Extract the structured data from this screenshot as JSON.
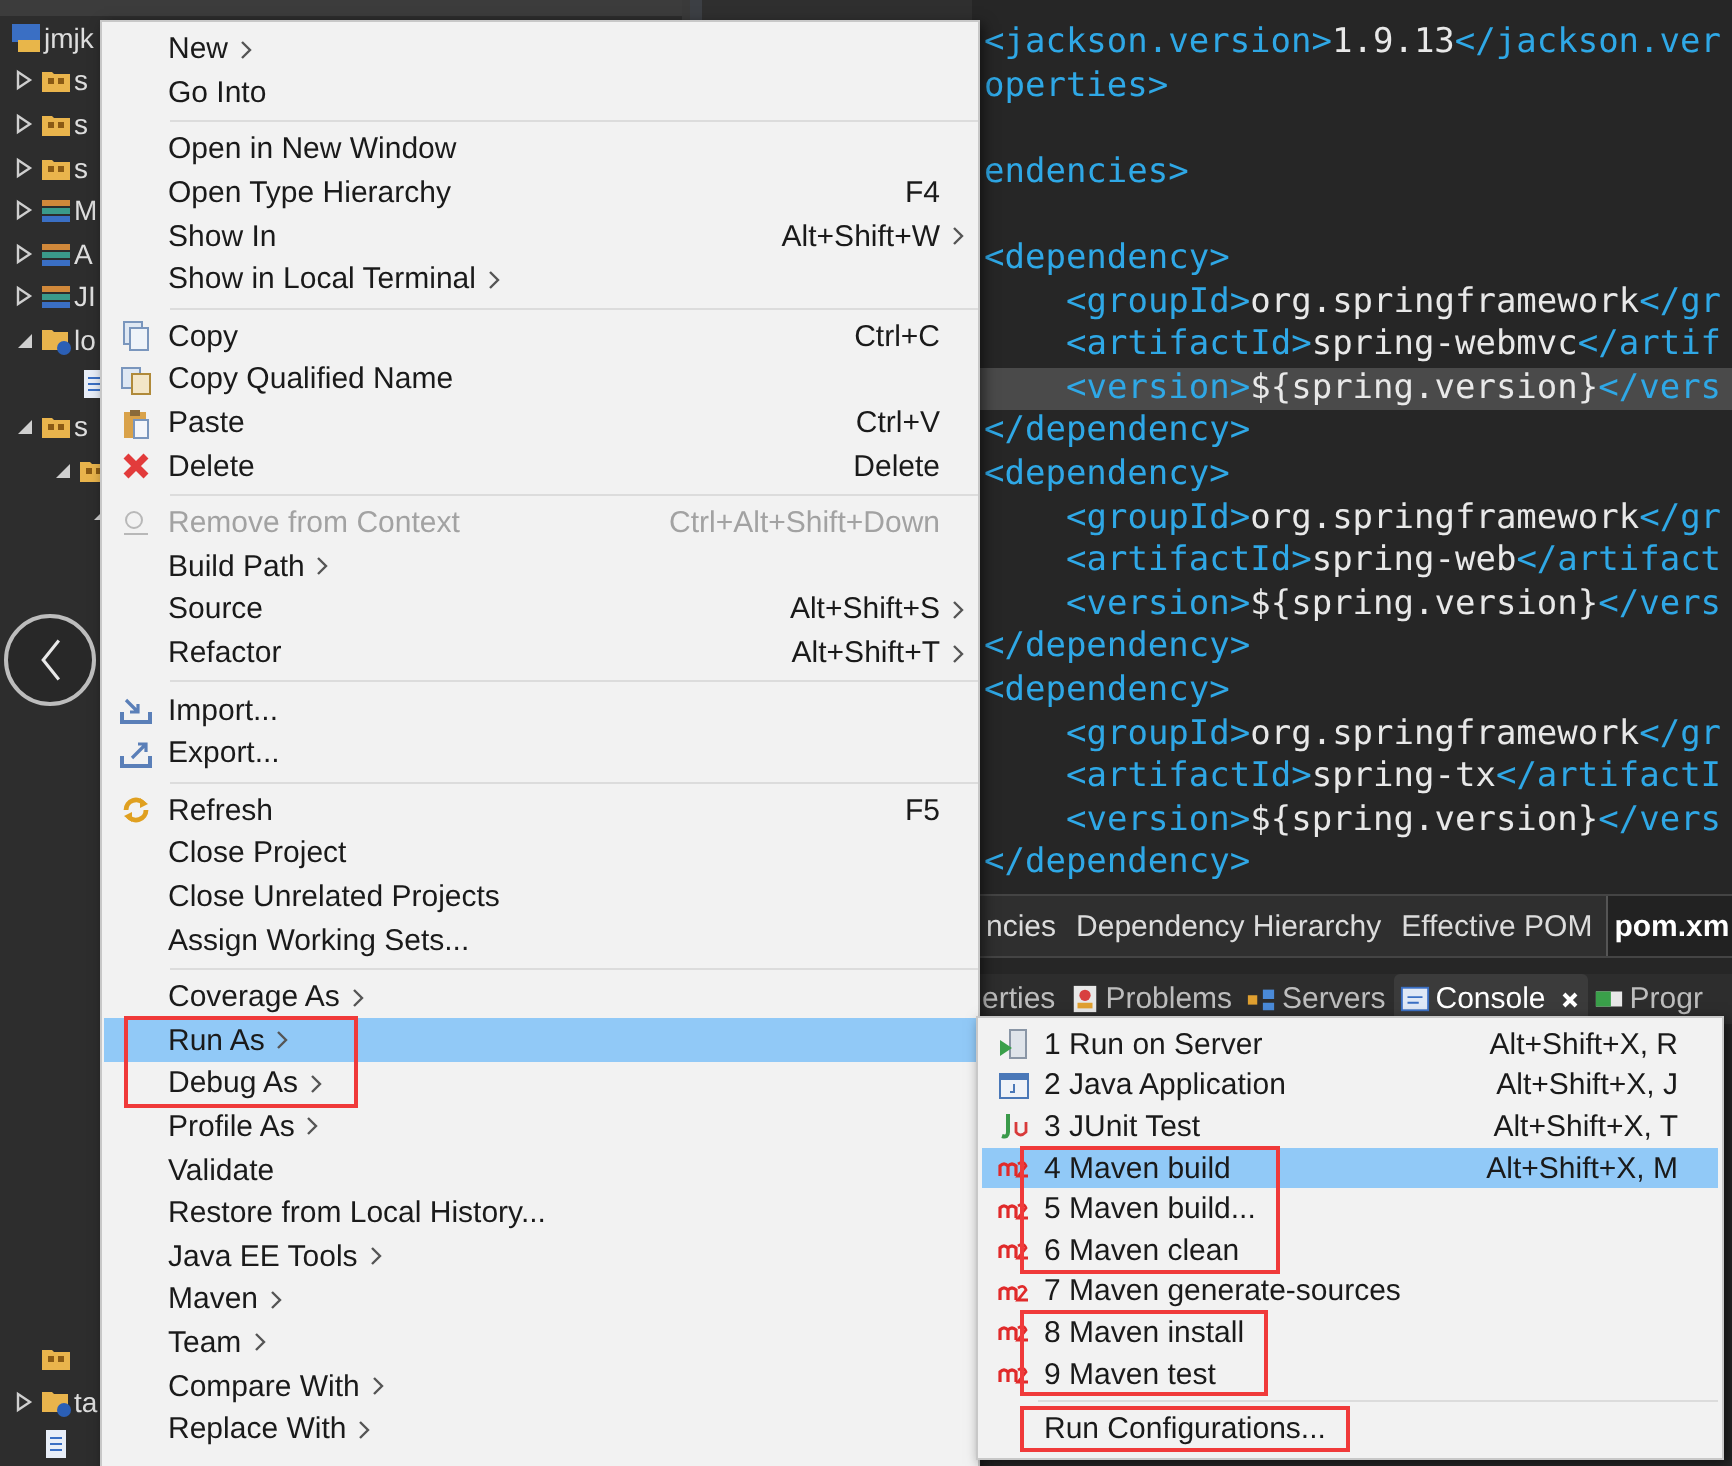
{
  "explorer": {
    "tree": [
      {
        "label": "jmjk",
        "kind": "project",
        "children": [
          {
            "label": "s",
            "kind": "package",
            "expanded": false
          },
          {
            "label": "s",
            "kind": "package",
            "expanded": false
          },
          {
            "label": "s",
            "kind": "package",
            "expanded": false
          },
          {
            "label": "M",
            "kind": "library",
            "expanded": false
          },
          {
            "label": "A",
            "kind": "library",
            "expanded": false
          },
          {
            "label": "JI",
            "kind": "library",
            "expanded": false
          },
          {
            "label": "lo",
            "kind": "folder",
            "expanded": true,
            "children": [
              {
                "kind": "file"
              }
            ]
          },
          {
            "label": "s",
            "kind": "package",
            "expanded": true,
            "children": [
              {
                "kind": "package",
                "expanded": true,
                "children": [
                  {
                    "expanded": true
                  }
                ]
              }
            ]
          }
        ]
      }
    ],
    "tree_end": [
      {
        "kind": "package"
      },
      {
        "label": "ta",
        "kind": "folder",
        "expanded": false
      },
      {
        "kind": "file"
      }
    ]
  },
  "editor": {
    "code": [
      {
        "current": false,
        "nested": false,
        "spaced": false,
        "segments": [
          {
            "kind": "tag",
            "text": "<jackson.version>"
          },
          {
            "kind": "value",
            "text": "1.9.13"
          },
          {
            "kind": "tag",
            "text": "</jackson.ver"
          }
        ]
      },
      {
        "current": false,
        "nested": false,
        "spaced": false,
        "segments": [
          {
            "kind": "tag",
            "text": "operties>"
          }
        ]
      },
      {
        "current": false,
        "nested": false,
        "spaced": true,
        "segments": [
          {
            "kind": "tag",
            "text": "endencies>"
          }
        ]
      },
      {
        "current": false,
        "nested": false,
        "spaced": true,
        "segments": [
          {
            "kind": "tag",
            "text": "<dependency>"
          }
        ]
      },
      {
        "current": false,
        "nested": true,
        "spaced": false,
        "segments": [
          {
            "kind": "tag",
            "text": "<groupId>"
          },
          {
            "kind": "value",
            "text": "org.springframework"
          },
          {
            "kind": "tag",
            "text": "</gr"
          }
        ]
      },
      {
        "current": false,
        "nested": true,
        "spaced": false,
        "segments": [
          {
            "kind": "tag",
            "text": "<artifactId>"
          },
          {
            "kind": "value",
            "text": "spring-webmvc"
          },
          {
            "kind": "tag",
            "text": "</artif"
          }
        ]
      },
      {
        "current": true,
        "nested": true,
        "spaced": false,
        "segments": [
          {
            "kind": "tag",
            "text": "<version>"
          },
          {
            "kind": "value",
            "text": "${spring.version}"
          },
          {
            "kind": "tag",
            "text": "</vers"
          }
        ]
      },
      {
        "current": false,
        "nested": false,
        "spaced": false,
        "segments": [
          {
            "kind": "tag",
            "text": "</dependency>"
          }
        ]
      },
      {
        "current": false,
        "nested": false,
        "spaced": false,
        "segments": [
          {
            "kind": "tag",
            "text": "<dependency>"
          }
        ]
      },
      {
        "current": false,
        "nested": true,
        "spaced": false,
        "segments": [
          {
            "kind": "tag",
            "text": "<groupId>"
          },
          {
            "kind": "value",
            "text": "org.springframework"
          },
          {
            "kind": "tag",
            "text": "</gr"
          }
        ]
      },
      {
        "current": false,
        "nested": true,
        "spaced": false,
        "segments": [
          {
            "kind": "tag",
            "text": "<artifactId>"
          },
          {
            "kind": "value",
            "text": "spring-web"
          },
          {
            "kind": "tag",
            "text": "</artifact"
          }
        ]
      },
      {
        "current": false,
        "nested": true,
        "spaced": false,
        "segments": [
          {
            "kind": "tag",
            "text": "<version>"
          },
          {
            "kind": "value",
            "text": "${spring.version}"
          },
          {
            "kind": "tag",
            "text": "</vers"
          }
        ]
      },
      {
        "current": false,
        "nested": false,
        "spaced": false,
        "segments": [
          {
            "kind": "tag",
            "text": "</dependency>"
          }
        ]
      },
      {
        "current": false,
        "nested": false,
        "spaced": false,
        "segments": [
          {
            "kind": "tag",
            "text": "<dependency>"
          }
        ]
      },
      {
        "current": false,
        "nested": true,
        "spaced": false,
        "segments": [
          {
            "kind": "tag",
            "text": "<groupId>"
          },
          {
            "kind": "value",
            "text": "org.springframework"
          },
          {
            "kind": "tag",
            "text": "</gr"
          }
        ]
      },
      {
        "current": false,
        "nested": true,
        "spaced": false,
        "segments": [
          {
            "kind": "tag",
            "text": "<artifactId>"
          },
          {
            "kind": "value",
            "text": "spring-tx"
          },
          {
            "kind": "tag",
            "text": "</artifactI"
          }
        ]
      },
      {
        "current": false,
        "nested": true,
        "spaced": false,
        "segments": [
          {
            "kind": "tag",
            "text": "<version>"
          },
          {
            "kind": "value",
            "text": "${spring.version}"
          },
          {
            "kind": "tag",
            "text": "</vers"
          }
        ]
      },
      {
        "current": false,
        "nested": false,
        "spaced": false,
        "segments": [
          {
            "kind": "tag",
            "text": "</dependency>"
          }
        ]
      }
    ],
    "tabs": [
      {
        "label": "ncies",
        "selected": false
      },
      {
        "label": "Dependency Hierarchy",
        "selected": false
      },
      {
        "label": "Effective POM",
        "selected": false
      },
      {
        "label": "pom.xm",
        "selected": true
      }
    ]
  },
  "views": {
    "tabs": [
      {
        "label": "erties",
        "kind": "plain",
        "selected": false,
        "closable": false
      },
      {
        "label": "Problems",
        "kind": "problems",
        "selected": false,
        "closable": false
      },
      {
        "label": "Servers",
        "kind": "servers",
        "selected": false,
        "closable": false
      },
      {
        "label": "Console",
        "kind": "console",
        "selected": true,
        "closable": true
      },
      {
        "label": "Progr",
        "kind": "progress",
        "selected": false,
        "closable": false
      }
    ]
  },
  "context_menu": {
    "groups": [
      [
        {
          "label": "New",
          "kind": "plain",
          "submenu": true,
          "selected": false,
          "disabled": false,
          "outlined": false
        },
        {
          "label": "Go Into",
          "kind": "plain",
          "submenu": false,
          "selected": false,
          "disabled": false,
          "outlined": false
        }
      ],
      [
        {
          "label": "Open in New Window",
          "kind": "plain",
          "submenu": false,
          "selected": false,
          "disabled": false,
          "outlined": false
        },
        {
          "label": "Open Type Hierarchy",
          "shortcut": "F4",
          "kind": "plain",
          "submenu": false,
          "selected": false,
          "disabled": false,
          "outlined": false
        },
        {
          "label": "Show In",
          "shortcut": "Alt+Shift+W",
          "kind": "plain",
          "submenu": true,
          "selected": false,
          "disabled": false,
          "outlined": false
        },
        {
          "label": "Show in Local Terminal",
          "kind": "plain",
          "submenu": true,
          "selected": false,
          "disabled": false,
          "outlined": false
        }
      ],
      [
        {
          "label": "Copy",
          "shortcut": "Ctrl+C",
          "kind": "copy",
          "submenu": false,
          "selected": false,
          "disabled": false,
          "outlined": false
        },
        {
          "label": "Copy Qualified Name",
          "kind": "copy-name",
          "submenu": false,
          "selected": false,
          "disabled": false,
          "outlined": false
        },
        {
          "label": "Paste",
          "shortcut": "Ctrl+V",
          "kind": "paste",
          "submenu": false,
          "selected": false,
          "disabled": false,
          "outlined": false
        },
        {
          "label": "Delete",
          "shortcut": "Delete",
          "kind": "delete",
          "submenu": false,
          "selected": false,
          "disabled": false,
          "outlined": false
        }
      ],
      [
        {
          "label": "Remove from Context",
          "shortcut": "Ctrl+Alt+Shift+Down",
          "kind": "remove",
          "submenu": false,
          "selected": false,
          "disabled": true,
          "outlined": false
        },
        {
          "label": "Build Path",
          "kind": "plain",
          "submenu": true,
          "selected": false,
          "disabled": false,
          "outlined": false
        },
        {
          "label": "Source",
          "shortcut": "Alt+Shift+S",
          "kind": "plain",
          "submenu": true,
          "selected": false,
          "disabled": false,
          "outlined": false
        },
        {
          "label": "Refactor",
          "shortcut": "Alt+Shift+T",
          "kind": "plain",
          "submenu": true,
          "selected": false,
          "disabled": false,
          "outlined": false
        }
      ],
      [
        {
          "label": "Import...",
          "kind": "import",
          "submenu": false,
          "selected": false,
          "disabled": false,
          "outlined": false
        },
        {
          "label": "Export...",
          "kind": "export",
          "submenu": false,
          "selected": false,
          "disabled": false,
          "outlined": false
        }
      ],
      [
        {
          "label": "Refresh",
          "shortcut": "F5",
          "kind": "refresh",
          "submenu": false,
          "selected": false,
          "disabled": false,
          "outlined": false
        },
        {
          "label": "Close Project",
          "kind": "plain",
          "submenu": false,
          "selected": false,
          "disabled": false,
          "outlined": false
        },
        {
          "label": "Close Unrelated Projects",
          "kind": "plain",
          "submenu": false,
          "selected": false,
          "disabled": false,
          "outlined": false
        },
        {
          "label": "Assign Working Sets...",
          "kind": "plain",
          "submenu": false,
          "selected": false,
          "disabled": false,
          "outlined": false
        }
      ],
      [
        {
          "label": "Coverage As",
          "kind": "plain",
          "submenu": true,
          "selected": false,
          "disabled": false,
          "outlined": false
        },
        {
          "label": "Run As",
          "kind": "plain",
          "submenu": true,
          "selected": true,
          "disabled": false,
          "outlined": true
        },
        {
          "label": "Debug As",
          "kind": "plain",
          "submenu": true,
          "selected": false,
          "disabled": false,
          "outlined": true
        },
        {
          "label": "Profile As",
          "kind": "plain",
          "submenu": true,
          "selected": false,
          "disabled": false,
          "outlined": false
        },
        {
          "label": "Validate",
          "kind": "plain",
          "submenu": false,
          "selected": false,
          "disabled": false,
          "outlined": false
        },
        {
          "label": "Restore from Local History...",
          "kind": "plain",
          "submenu": false,
          "selected": false,
          "disabled": false,
          "outlined": false
        },
        {
          "label": "Java EE Tools",
          "kind": "plain",
          "submenu": true,
          "selected": false,
          "disabled": false,
          "outlined": false
        },
        {
          "label": "Maven",
          "kind": "plain",
          "submenu": true,
          "selected": false,
          "disabled": false,
          "outlined": false
        },
        {
          "label": "Team",
          "kind": "plain",
          "submenu": true,
          "selected": false,
          "disabled": false,
          "outlined": false
        },
        {
          "label": "Compare With",
          "kind": "plain",
          "submenu": true,
          "selected": false,
          "disabled": false,
          "outlined": false
        },
        {
          "label": "Replace With",
          "kind": "plain",
          "submenu": true,
          "selected": false,
          "disabled": false,
          "outlined": false
        }
      ]
    ]
  },
  "run_as_menu": {
    "groups": [
      [
        {
          "label": "1 Run on Server",
          "shortcut": "Alt+Shift+X, R",
          "kind": "server",
          "selected": false,
          "outlined": false
        },
        {
          "label": "2 Java Application",
          "shortcut": "Alt+Shift+X, J",
          "kind": "java-app",
          "selected": false,
          "outlined": false
        },
        {
          "label": "3 JUnit Test",
          "shortcut": "Alt+Shift+X, T",
          "kind": "junit",
          "selected": false,
          "outlined": false
        },
        {
          "label": "4 Maven build",
          "shortcut": "Alt+Shift+X, M",
          "kind": "maven",
          "selected": true,
          "outlined": true
        },
        {
          "label": "5 Maven build...",
          "kind": "maven",
          "selected": false,
          "outlined": true
        },
        {
          "label": "6 Maven clean",
          "kind": "maven",
          "selected": false,
          "outlined": true
        },
        {
          "label": "7 Maven generate-sources",
          "kind": "maven",
          "selected": false,
          "outlined": false
        },
        {
          "label": "8 Maven install",
          "kind": "maven",
          "selected": false,
          "outlined": true
        },
        {
          "label": "9 Maven test",
          "kind": "maven",
          "selected": false,
          "outlined": true
        }
      ],
      [
        {
          "label": "Run Configurations...",
          "kind": "plain",
          "selected": false,
          "outlined": true
        }
      ]
    ]
  }
}
